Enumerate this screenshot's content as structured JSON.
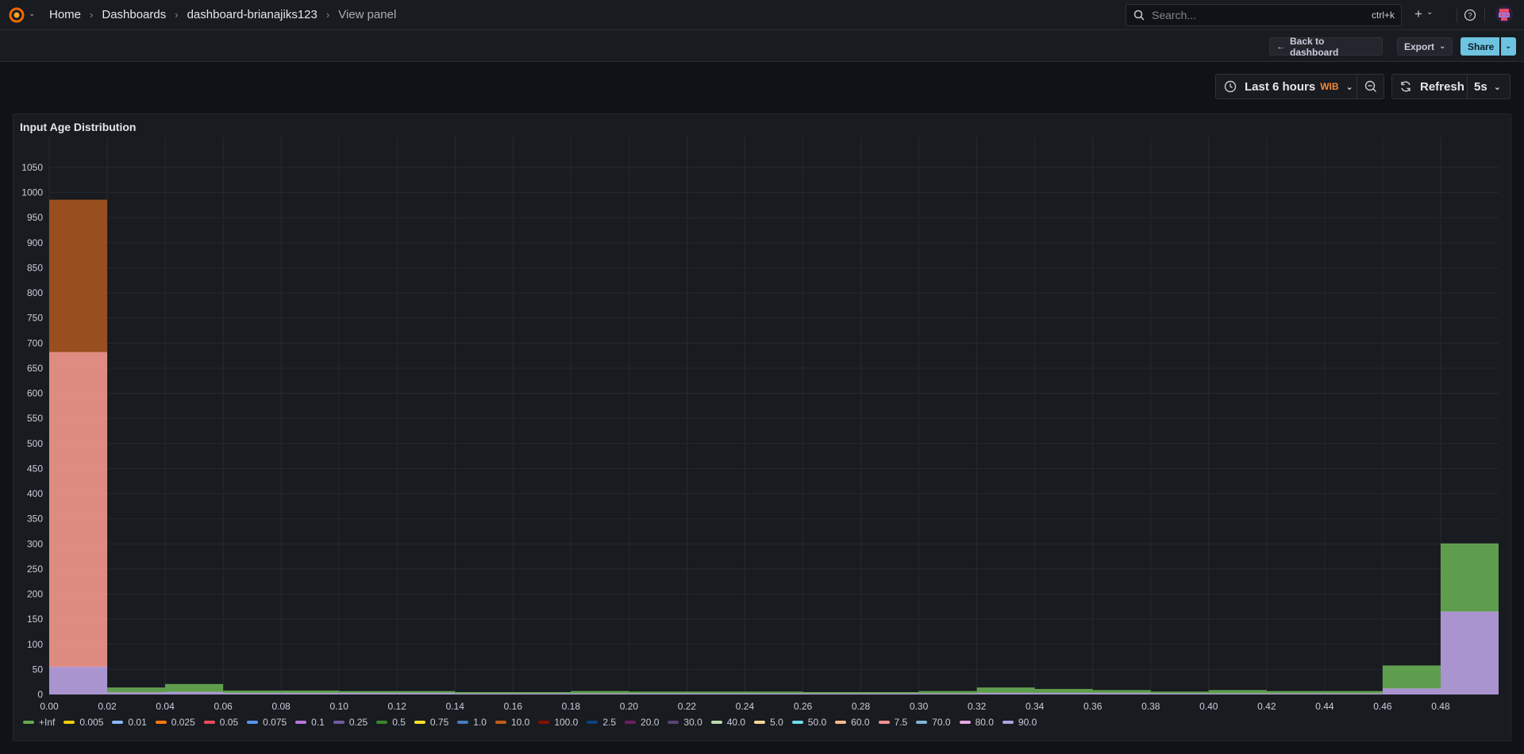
{
  "nav": {
    "breadcrumbs": [
      "Home",
      "Dashboards",
      "dashboard-brianajiks123",
      "View panel"
    ],
    "search_placeholder": "Search...",
    "search_shortcut": "ctrl+k",
    "add_icon": "plus-icon",
    "help_icon": "help-icon"
  },
  "toolbar": {
    "back_label": "Back to dashboard",
    "export_label": "Export",
    "share_label": "Share"
  },
  "timepicker": {
    "range_label": "Last 6 hours",
    "timezone": "WIB",
    "refresh_label": "Refresh",
    "refresh_interval": "5s"
  },
  "panel": {
    "title": "Input Age Distribution"
  },
  "colors": {
    "accent": "#6ec3e0",
    "timezone": "#f08a3c",
    "series_inf": "#66a852",
    "series_lavender": "#b69ee0",
    "series_salmon": "#f0958a",
    "series_orange": "#a4531f"
  },
  "chart_data": {
    "type": "bar",
    "stacked": true,
    "xlim": [
      0,
      0.5
    ],
    "ylim": [
      0,
      1080
    ],
    "x_ticks": [
      "0.00",
      "0.02",
      "0.04",
      "0.06",
      "0.08",
      "0.10",
      "0.12",
      "0.14",
      "0.16",
      "0.18",
      "0.20",
      "0.22",
      "0.24",
      "0.26",
      "0.28",
      "0.30",
      "0.32",
      "0.34",
      "0.36",
      "0.38",
      "0.40",
      "0.42",
      "0.44",
      "0.46",
      "0.48"
    ],
    "y_ticks": [
      "0",
      "50",
      "100",
      "150",
      "200",
      "250",
      "300",
      "350",
      "400",
      "450",
      "500",
      "550",
      "600",
      "650",
      "700",
      "750",
      "800",
      "850",
      "900",
      "950",
      "1000",
      "1050"
    ],
    "grid": true,
    "legend_placement": "bottom",
    "bin_width": 0.02,
    "bins": [
      0.0,
      0.02,
      0.04,
      0.06,
      0.08,
      0.1,
      0.12,
      0.14,
      0.16,
      0.18,
      0.2,
      0.22,
      0.24,
      0.26,
      0.28,
      0.3,
      0.32,
      0.34,
      0.36,
      0.38,
      0.4,
      0.42,
      0.44,
      0.46,
      0.48
    ],
    "series": [
      {
        "name": "90.0",
        "color": "#b69ee0",
        "values": [
          55,
          4,
          5,
          3,
          3,
          3,
          3,
          2,
          2,
          2,
          2,
          2,
          2,
          2,
          2,
          2,
          3,
          3,
          3,
          2,
          2,
          2,
          2,
          12,
          165
        ]
      },
      {
        "name": "7.5",
        "color": "#f0958a",
        "values": [
          627,
          0,
          0,
          0,
          0,
          0,
          0,
          0,
          0,
          0,
          0,
          0,
          0,
          0,
          0,
          0,
          0,
          0,
          0,
          0,
          0,
          0,
          0,
          0,
          0
        ]
      },
      {
        "name": "10.0",
        "color": "#a4531f",
        "values": [
          303,
          0,
          0,
          0,
          0,
          0,
          0,
          0,
          0,
          0,
          0,
          0,
          0,
          0,
          0,
          0,
          0,
          0,
          0,
          0,
          0,
          0,
          0,
          0,
          0
        ]
      },
      {
        "name": "+Inf",
        "color": "#66a852",
        "values": [
          0,
          9,
          15,
          4,
          4,
          3,
          3,
          2,
          2,
          4,
          3,
          3,
          3,
          2,
          2,
          4,
          10,
          7,
          5,
          3,
          6,
          4,
          4,
          45,
          135
        ]
      }
    ],
    "legend": [
      {
        "name": "+Inf",
        "color": "#66a852"
      },
      {
        "name": "0.005",
        "color": "#f2cc0c"
      },
      {
        "name": "0.01",
        "color": "#8ab8ff"
      },
      {
        "name": "0.025",
        "color": "#ff780a"
      },
      {
        "name": "0.05",
        "color": "#f2495c"
      },
      {
        "name": "0.075",
        "color": "#5794f2"
      },
      {
        "name": "0.1",
        "color": "#b877d9"
      },
      {
        "name": "0.25",
        "color": "#705da0"
      },
      {
        "name": "0.5",
        "color": "#37872d"
      },
      {
        "name": "0.75",
        "color": "#fade2a"
      },
      {
        "name": "1.0",
        "color": "#447ebc"
      },
      {
        "name": "10.0",
        "color": "#c15c17"
      },
      {
        "name": "100.0",
        "color": "#890f02"
      },
      {
        "name": "2.5",
        "color": "#0a437c"
      },
      {
        "name": "20.0",
        "color": "#6d1f62"
      },
      {
        "name": "30.0",
        "color": "#584477"
      },
      {
        "name": "40.0",
        "color": "#b7dbab"
      },
      {
        "name": "5.0",
        "color": "#f4d598"
      },
      {
        "name": "50.0",
        "color": "#70dbed"
      },
      {
        "name": "60.0",
        "color": "#f9ba8f"
      },
      {
        "name": "7.5",
        "color": "#f29191"
      },
      {
        "name": "70.0",
        "color": "#82b5d8"
      },
      {
        "name": "80.0",
        "color": "#e5a8e2"
      },
      {
        "name": "90.0",
        "color": "#aea2e0"
      }
    ]
  }
}
